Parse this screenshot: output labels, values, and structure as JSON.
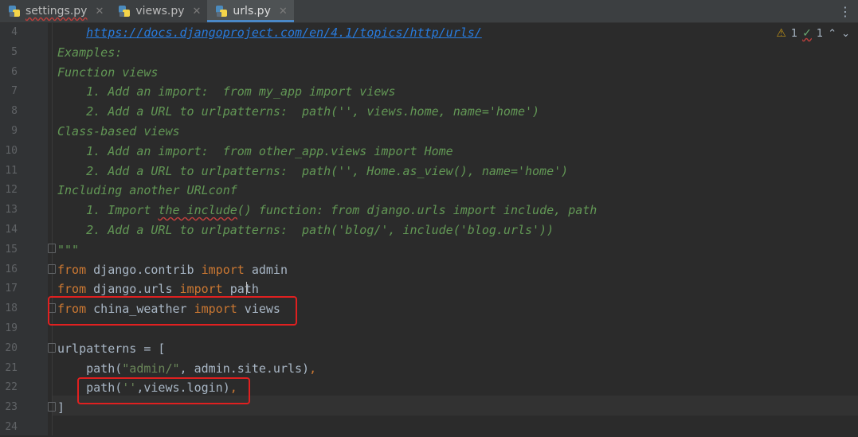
{
  "tabs": [
    {
      "label": "settings.py",
      "active": false
    },
    {
      "label": "views.py",
      "active": false
    },
    {
      "label": "urls.py",
      "active": true
    }
  ],
  "inspection": {
    "warnings": "1",
    "typos": "1"
  },
  "colors": {
    "background": "#2b2b2b",
    "keyword": "#cc7832",
    "docstring": "#629755",
    "string": "#6a8759",
    "highlight": "#e02020"
  },
  "lines": [
    {
      "n": "4",
      "parts": [
        {
          "t": "    ",
          "c": ""
        },
        {
          "t": "https://docs.djangoproject.com/en/4.1/topics/http/urls/",
          "c": "link"
        }
      ]
    },
    {
      "n": "5",
      "parts": [
        {
          "t": "Examples:",
          "c": "doc"
        }
      ]
    },
    {
      "n": "6",
      "parts": [
        {
          "t": "Function views",
          "c": "doc"
        }
      ]
    },
    {
      "n": "7",
      "parts": [
        {
          "t": "    1. Add an import:  from my_app import views",
          "c": "doc"
        }
      ]
    },
    {
      "n": "8",
      "parts": [
        {
          "t": "    2. Add a URL to urlpatterns:  path('', views.home, name='home')",
          "c": "doc"
        }
      ]
    },
    {
      "n": "9",
      "parts": [
        {
          "t": "Class-based views",
          "c": "doc"
        }
      ]
    },
    {
      "n": "10",
      "parts": [
        {
          "t": "    1. Add an import:  from other_app.views import Home",
          "c": "doc"
        }
      ]
    },
    {
      "n": "11",
      "parts": [
        {
          "t": "    2. Add a URL to urlpatterns:  path('', Home.as_view(), name='home')",
          "c": "doc"
        }
      ]
    },
    {
      "n": "12",
      "parts": [
        {
          "t": "Including another URLconf",
          "c": "doc"
        }
      ]
    },
    {
      "n": "13",
      "parts": [
        {
          "t": "    1. Import ",
          "c": "doc"
        },
        {
          "t": "the include",
          "c": "doc red-wave"
        },
        {
          "t": "() function: from django.urls import include, path",
          "c": "doc"
        }
      ]
    },
    {
      "n": "14",
      "parts": [
        {
          "t": "    2. Add a URL to urlpatterns:  path('blog/', include('blog.urls'))",
          "c": "doc"
        }
      ]
    },
    {
      "n": "15",
      "parts": [
        {
          "t": "\"\"\"",
          "c": "doc"
        }
      ]
    },
    {
      "n": "16",
      "parts": [
        {
          "t": "from",
          "c": "kw"
        },
        {
          "t": " django.contrib ",
          "c": ""
        },
        {
          "t": "import",
          "c": "kw"
        },
        {
          "t": " admin",
          "c": ""
        }
      ]
    },
    {
      "n": "17",
      "parts": [
        {
          "t": "from",
          "c": "kw"
        },
        {
          "t": " django.urls ",
          "c": ""
        },
        {
          "t": "import",
          "c": "kw"
        },
        {
          "t": " path",
          "c": ""
        }
      ]
    },
    {
      "n": "18",
      "parts": [
        {
          "t": "from",
          "c": "kw"
        },
        {
          "t": " china_weather ",
          "c": ""
        },
        {
          "t": "import",
          "c": "kw"
        },
        {
          "t": " views",
          "c": ""
        }
      ]
    },
    {
      "n": "19",
      "parts": []
    },
    {
      "n": "20",
      "parts": [
        {
          "t": "urlpatterns = [",
          "c": ""
        }
      ]
    },
    {
      "n": "21",
      "parts": [
        {
          "t": "    path(",
          "c": ""
        },
        {
          "t": "\"admin/\"",
          "c": "str"
        },
        {
          "t": ", admin.site.urls)",
          "c": ""
        },
        {
          "t": ",",
          "c": "kw"
        }
      ]
    },
    {
      "n": "22",
      "parts": [
        {
          "t": "    path(",
          "c": ""
        },
        {
          "t": "''",
          "c": "str"
        },
        {
          "t": ",views.login)",
          "c": ""
        },
        {
          "t": ",",
          "c": "kw"
        }
      ]
    },
    {
      "n": "23",
      "parts": [
        {
          "t": "]",
          "c": ""
        }
      ]
    },
    {
      "n": "24",
      "parts": []
    }
  ]
}
